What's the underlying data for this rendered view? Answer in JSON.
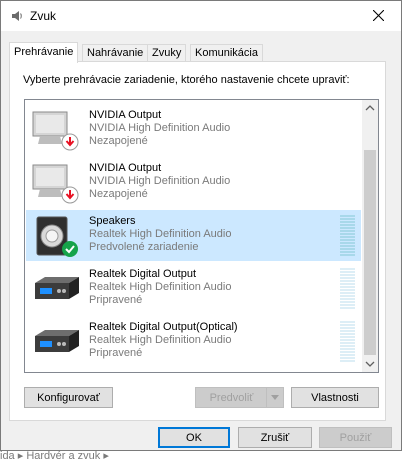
{
  "window": {
    "title": "Zvuk"
  },
  "tabs": [
    {
      "label": "Prehrávanie"
    },
    {
      "label": "Nahrávanie"
    },
    {
      "label": "Zvuky"
    },
    {
      "label": "Komunikácia"
    }
  ],
  "prompt": "Vyberte prehrávacie zariadenie, ktorého nastavenie chcete upraviť:",
  "devices": [
    {
      "name": "NVIDIA Output",
      "driver": "NVIDIA High Definition Audio",
      "status": "Nezapojené",
      "icon": "monitor-icon",
      "badge": "disconnected-badge-icon"
    },
    {
      "name": "NVIDIA Output",
      "driver": "NVIDIA High Definition Audio",
      "status": "Nezapojené",
      "icon": "monitor-icon",
      "badge": "disconnected-badge-icon"
    },
    {
      "name": "Speakers",
      "driver": "Realtek High Definition Audio",
      "status": "Predvolené zariadenie",
      "icon": "speaker-icon",
      "badge": "default-check-badge-icon",
      "selected": true
    },
    {
      "name": "Realtek Digital Output",
      "driver": "Realtek High Definition Audio",
      "status": "Pripravené",
      "icon": "digital-output-icon"
    },
    {
      "name": "Realtek Digital Output(Optical)",
      "driver": "Realtek High Definition Audio",
      "status": "Pripravené",
      "icon": "digital-output-icon"
    }
  ],
  "buttons": {
    "configure": "Konfigurovať",
    "set_default": "Predvoliť",
    "properties": "Vlastnosti",
    "ok": "OK",
    "cancel": "Zrušiť",
    "apply": "Použiť"
  },
  "background_text": "ida ▸ Hardvér a zvuk ▸",
  "colors": {
    "selection": "#cce8ff",
    "accent": "#0078d7",
    "disconnected": "#e81123",
    "ready_check": "#16a34a"
  }
}
